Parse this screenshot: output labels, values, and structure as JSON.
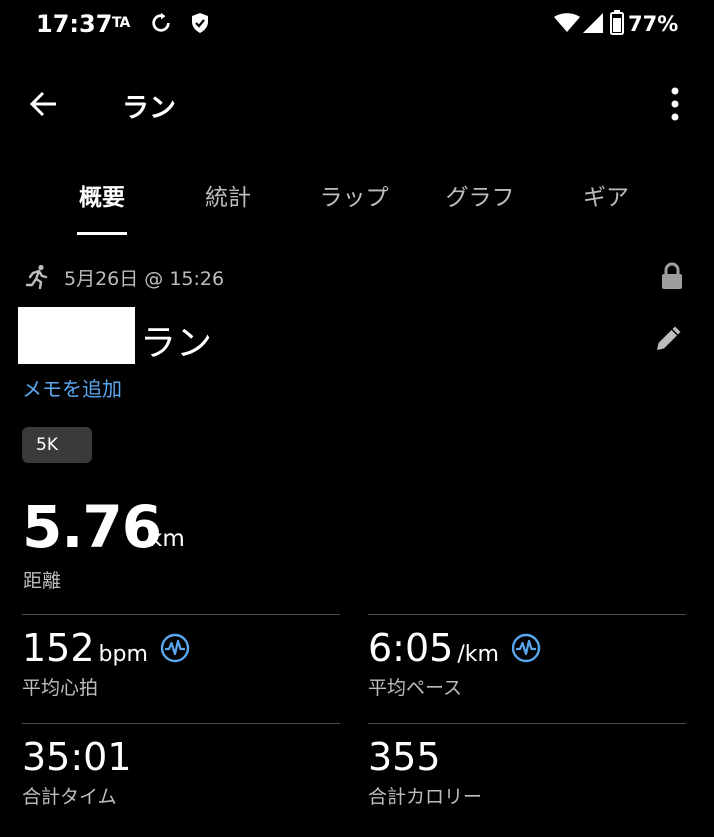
{
  "status_bar": {
    "time": "17:37",
    "ta": "TA",
    "battery": "77%"
  },
  "header": {
    "title": "ラン"
  },
  "tabs": [
    {
      "label": "概要",
      "active": true
    },
    {
      "label": "統計",
      "active": false
    },
    {
      "label": "ラップ",
      "active": false
    },
    {
      "label": "グラフ",
      "active": false
    },
    {
      "label": "ギア",
      "active": false
    }
  ],
  "activity": {
    "date": "5月26日 @ 15:26",
    "name": "ラン",
    "add_memo": "メモを追加",
    "badge": "5K"
  },
  "distance": {
    "value": "5.76",
    "unit": "km",
    "label": "距離"
  },
  "stats": [
    {
      "value": "152",
      "unit": "bpm",
      "label": "平均心拍",
      "icon": "pulse-icon"
    },
    {
      "value": "6:05",
      "unit": "/km",
      "label": "平均ペース",
      "icon": "pulse-icon"
    },
    {
      "value": "35:01",
      "unit": "",
      "label": "合計タイム"
    },
    {
      "value": "355",
      "unit": "",
      "label": "合計カロリー"
    }
  ],
  "colors": {
    "accent_link": "#5aa7f0",
    "background": "#000000",
    "secondary_text": "#bdbdbd"
  }
}
